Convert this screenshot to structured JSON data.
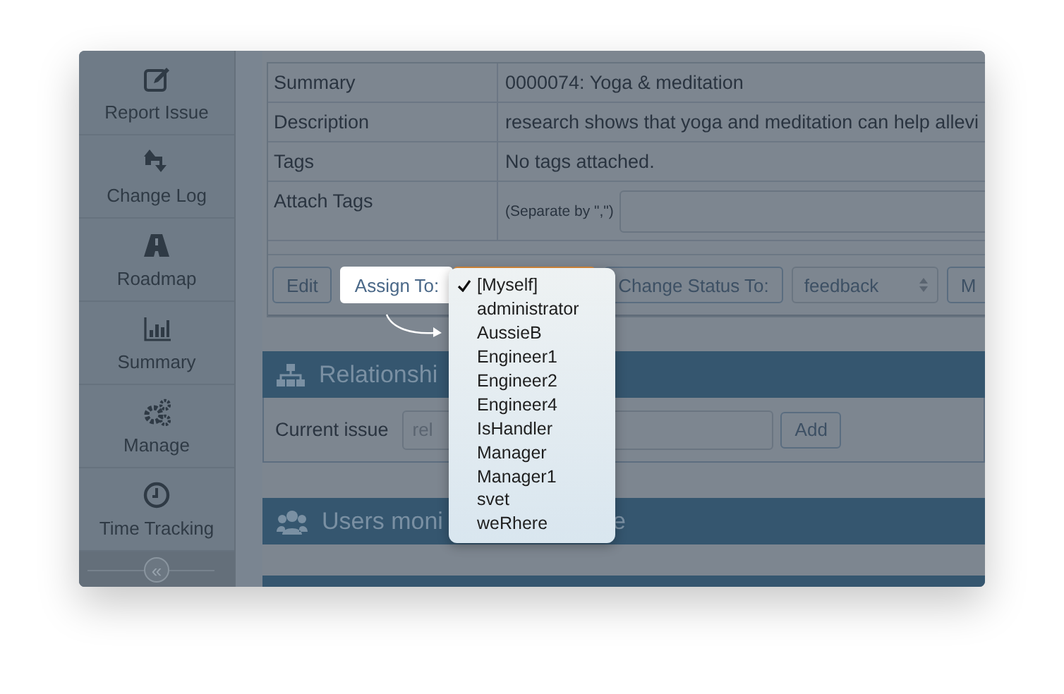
{
  "sidebar": {
    "items": [
      {
        "label": "Report Issue"
      },
      {
        "label": "Change Log"
      },
      {
        "label": "Roadmap"
      },
      {
        "label": "Summary"
      },
      {
        "label": "Manage"
      },
      {
        "label": "Time Tracking"
      }
    ],
    "collapse": "«"
  },
  "issue_table": {
    "rows": [
      {
        "label": "Summary",
        "value": "0000074: Yoga & meditation"
      },
      {
        "label": "Description",
        "value": "research shows that yoga and meditation can help allevi"
      },
      {
        "label": "Tags",
        "value": "No tags attached."
      },
      {
        "label": "Attach Tags",
        "hint": "(Separate by \",\")"
      }
    ]
  },
  "actions": {
    "edit_button": "Edit",
    "assign_button": {
      "label": "Assign To:",
      "highlighted": true
    },
    "assign_dropdown": {
      "options": [
        {
          "label": "[Myself]",
          "selected": true
        },
        {
          "label": "administrator",
          "selected": false
        },
        {
          "label": "AussieB",
          "selected": false
        },
        {
          "label": "Engineer1",
          "selected": false
        },
        {
          "label": "Engineer2",
          "selected": false
        },
        {
          "label": "Engineer4",
          "selected": false
        },
        {
          "label": "IsHandler",
          "selected": false
        },
        {
          "label": "Manager",
          "selected": false
        },
        {
          "label": "Manager1",
          "selected": false
        },
        {
          "label": "svet",
          "selected": false
        },
        {
          "label": "weRhere",
          "selected": false
        }
      ]
    },
    "status_button": "Change Status To:",
    "status_select": {
      "value": "feedback"
    },
    "next_button": "M"
  },
  "relationships": {
    "title": "Relationshi",
    "current_issue_label": "Current issue",
    "issue_field": {
      "placeholder": "rel"
    },
    "add_button": "Add"
  },
  "monitoring": {
    "title_parts": [
      "Users moni",
      "e"
    ]
  }
}
